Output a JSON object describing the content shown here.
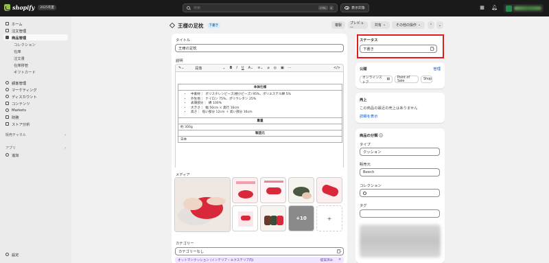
{
  "topbar": {
    "logo_text": "shopify",
    "logo_badge": "2025年夏",
    "search_placeholder": "検索",
    "shortcut_1": "CTRL",
    "shortcut_2": "K",
    "preview_label": "表示対象"
  },
  "sidebar": {
    "items": [
      {
        "label": "ホーム",
        "icon": "home-icon"
      },
      {
        "label": "注文管理",
        "icon": "inbox-icon"
      },
      {
        "label": "商品管理",
        "icon": "tag-icon"
      },
      {
        "label": "コレクション"
      },
      {
        "label": "在庫"
      },
      {
        "label": "注文書"
      },
      {
        "label": "在庫移管"
      },
      {
        "label": "ギフトカード"
      },
      {
        "label": "顧客管理",
        "icon": "person-icon"
      },
      {
        "label": "マーケティング",
        "icon": "target-icon"
      },
      {
        "label": "ディスカウント",
        "icon": "discount-icon"
      },
      {
        "label": "コンテンツ",
        "icon": "content-icon"
      },
      {
        "label": "Markets",
        "icon": "globe-icon"
      },
      {
        "label": "財務",
        "icon": "bank-icon"
      },
      {
        "label": "ストア分析",
        "icon": "chart-icon"
      }
    ],
    "sales_channels": "販売チャネル",
    "apps": "アプリ",
    "add": "追加",
    "settings": "設定"
  },
  "header": {
    "title": "王様の足枕",
    "status_badge": "下書き",
    "buttons": [
      "複製",
      "プレビュー",
      "共有",
      "その他の操作"
    ]
  },
  "product": {
    "title_label": "タイトル",
    "title_value": "王様の足枕",
    "description_label": "説明",
    "paragraph_style": "段落",
    "spec_heading": "本体仕様",
    "spec_items": [
      "中素材 ： ポリスチレンビーズ(極小ビーズ) 95%、ポリエステル綿 5%",
      "外生地 ： ナイロン 75%、ポリウレタン 25%",
      "表頭部分 ： 綿 100%",
      "大きさ ： 幅 50cm × 奥行 16cm",
      "高さ ： 低い部分 12cm ＋ 高い部分 16cm"
    ],
    "weight_heading": "重量",
    "weight_value": "約 300g",
    "origin_heading": "製造元",
    "origin_value": "日本",
    "media_label": "メディア",
    "more_media": "+10",
    "add_media": "+",
    "category_label": "カテゴリー",
    "category_value": "カテゴリーなし",
    "category_suggestion": "オットマンクッション (インテリア・エクステリア内)",
    "suggestion_action": "提案済み"
  },
  "status": {
    "label": "ステータス",
    "value": "下書き"
  },
  "publishing": {
    "label": "公開",
    "manage": "管理",
    "channels": [
      "オンラインストア",
      "Point of Sale",
      "Shop"
    ]
  },
  "sales": {
    "label": "売上",
    "text": "この商品の最近の売上はありません",
    "link": "詳細を表示"
  },
  "organization": {
    "label": "商品の分類",
    "type_label": "タイプ",
    "type_value": "クッション",
    "vendor_label": "販売元",
    "vendor_value": "Beech",
    "collections_label": "コレクション",
    "tags_label": "タグ"
  },
  "colors": {
    "accent": "#005bd3",
    "highlight": "#e01b1b",
    "product_red": "#d8283a"
  }
}
